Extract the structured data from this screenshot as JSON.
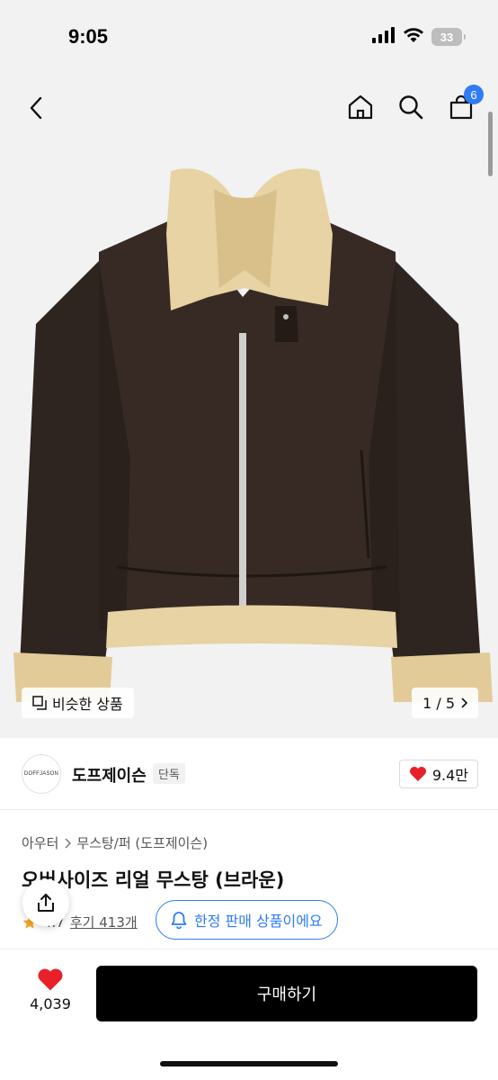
{
  "status_bar": {
    "time": "9:05",
    "battery": "33"
  },
  "nav": {
    "cart_count": "6"
  },
  "hero": {
    "similar_label": "비슷한 상품",
    "page_indicator": "1 / 5"
  },
  "brand": {
    "logo_text": "DOFFJASON",
    "name": "도프제이슨",
    "tag": "단독",
    "likes": "9.4만"
  },
  "product": {
    "breadcrumb": [
      "아우터",
      "무스탕/퍼 (도프제이슨)"
    ],
    "title": "오버사이즈 리얼 무스탕 (브라운)",
    "rating": "4.7",
    "reviews": "후기 413개",
    "limited_label": "한정 판매 상품이에요"
  },
  "bottom": {
    "fav_count": "4,039",
    "buy_label": "구매하기"
  },
  "colors": {
    "accent_blue": "#2f7cf6",
    "heart_red": "#e8202a",
    "star_orange": "#f5a623",
    "leather": "#2e2420",
    "fur": "#e7d3a3"
  }
}
